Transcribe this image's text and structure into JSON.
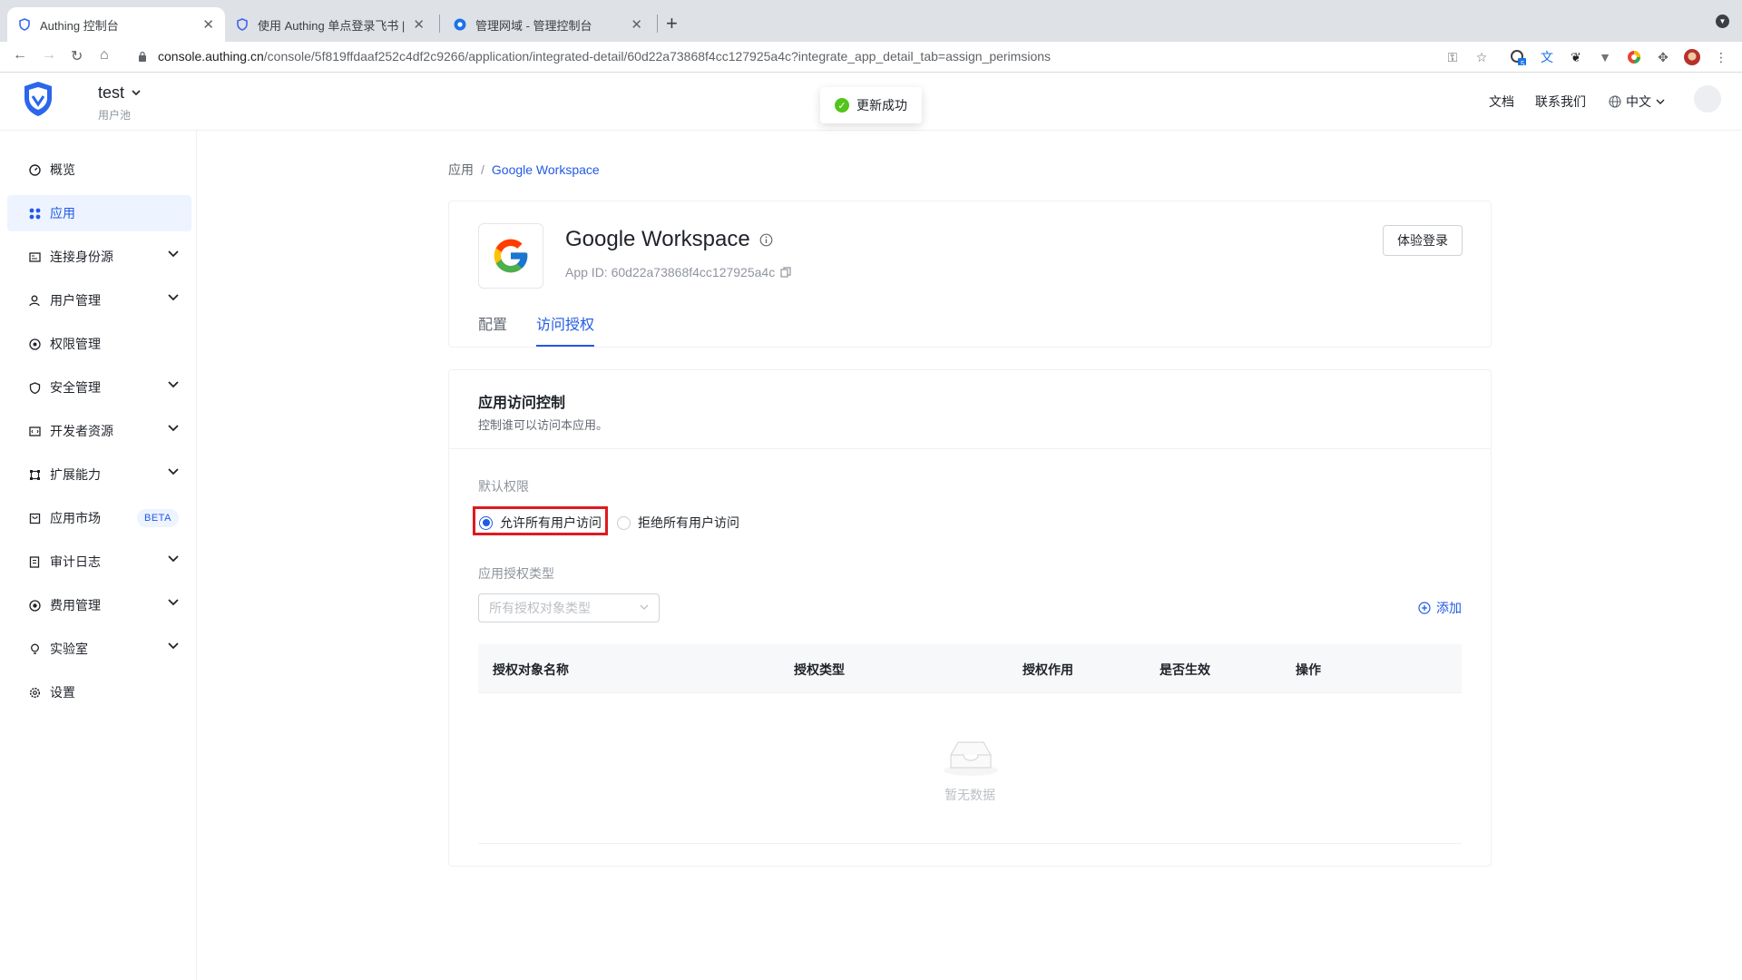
{
  "browser": {
    "tabs": [
      {
        "title": "Authing 控制台"
      },
      {
        "title": "使用 Authing 单点登录飞书 | Aut"
      },
      {
        "title": "管理网域 - 管理控制台"
      }
    ],
    "url_host": "console.authing.cn",
    "url_path": "/console/5f819ffdaaf252c4df2c9266/application/integrated-detail/60d22a73868f4cc127925a4c?integrate_app_detail_tab=assign_perimsions",
    "extension_badge": "5"
  },
  "header": {
    "pool_name": "test",
    "pool_sub": "用户池",
    "docs": "文档",
    "contact": "联系我们",
    "language": "中文"
  },
  "toast": {
    "text": "更新成功"
  },
  "sidebar": {
    "items": [
      {
        "label": "概览"
      },
      {
        "label": "应用"
      },
      {
        "label": "连接身份源"
      },
      {
        "label": "用户管理"
      },
      {
        "label": "权限管理"
      },
      {
        "label": "安全管理"
      },
      {
        "label": "开发者资源"
      },
      {
        "label": "扩展能力"
      },
      {
        "label": "应用市场"
      },
      {
        "label": "审计日志"
      },
      {
        "label": "费用管理"
      },
      {
        "label": "实验室"
      },
      {
        "label": "设置"
      }
    ],
    "beta_badge": "BETA"
  },
  "breadcrumb": {
    "parent": "应用",
    "separator": "/",
    "current": "Google Workspace"
  },
  "app": {
    "name": "Google Workspace",
    "app_id": "App ID:  60d22a73868f4cc127925a4c",
    "try_login": "体验登录",
    "tabs": [
      "配置",
      "访问授权"
    ],
    "active_tab": "访问授权"
  },
  "access": {
    "title": "应用访问控制",
    "desc": "控制谁可以访问本应用。",
    "default_label": "默认权限",
    "allow_all": "允许所有用户访问",
    "deny_all": "拒绝所有用户访问",
    "selected": "allow_all",
    "type_label": "应用授权类型",
    "type_placeholder": "所有授权对象类型",
    "add": "添加",
    "columns": [
      "授权对象名称",
      "授权类型",
      "授权作用",
      "是否生效",
      "操作"
    ],
    "rows": [],
    "empty": "暂无数据"
  },
  "colors": {
    "accent": "#215ae5",
    "success": "#52c41a",
    "highlight": "#e0191e"
  }
}
